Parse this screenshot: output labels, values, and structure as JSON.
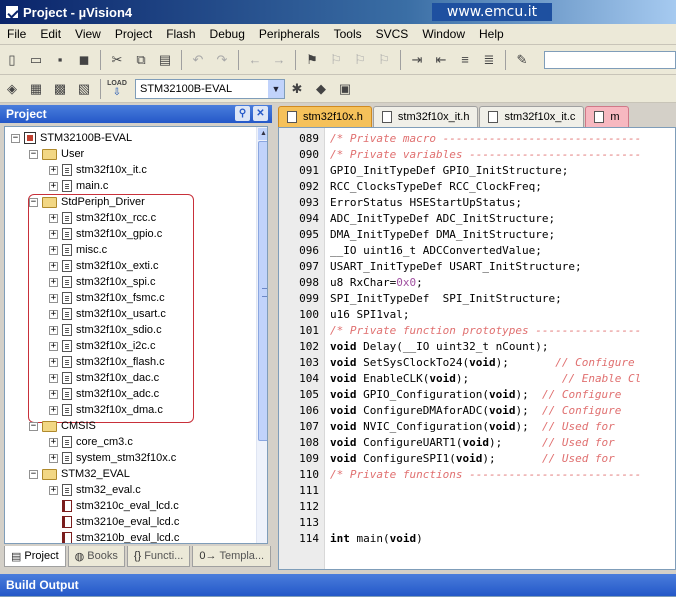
{
  "window": {
    "title": "Project - µVision4",
    "watermark": "www.emcu.it"
  },
  "menu": [
    "File",
    "Edit",
    "View",
    "Project",
    "Flash",
    "Debug",
    "Peripherals",
    "Tools",
    "SVCS",
    "Window",
    "Help"
  ],
  "toolbar": {
    "target_select": "STM32100B-EVAL",
    "load_label": "LOAD",
    "icons1": [
      "new-file-icon",
      "open-folder-icon",
      "save-icon",
      "save-all-icon",
      "cut-icon",
      "copy-icon",
      "paste-icon",
      "undo-icon",
      "redo-icon",
      "nav-back-icon",
      "nav-forward-icon",
      "bookmark-icon",
      "bookmark-prev-icon",
      "bookmark-next-icon",
      "bookmark-clear-icon",
      "indent-icon",
      "unindent-icon",
      "comment-icon",
      "uncomment-icon",
      "find-in-files-icon"
    ],
    "icons2": [
      "translate-icon",
      "build-icon",
      "rebuild-icon",
      "batch-build-icon",
      "download-icon",
      "target-options-icon",
      "manage-components-icon",
      "books-window-icon"
    ]
  },
  "project_panel": {
    "title": "Project",
    "tree": [
      {
        "label": "STM32100B-EVAL",
        "type": "project",
        "level": 0,
        "expander": "-"
      },
      {
        "label": "User",
        "type": "folder",
        "level": 1,
        "expander": "-"
      },
      {
        "label": "stm32f10x_it.c",
        "type": "file",
        "level": 2,
        "expander": "+"
      },
      {
        "label": "main.c",
        "type": "file",
        "level": 2,
        "expander": "+"
      },
      {
        "label": "StdPeriph_Driver",
        "type": "folder",
        "level": 1,
        "expander": "-"
      },
      {
        "label": "stm32f10x_rcc.c",
        "type": "file",
        "level": 2,
        "expander": "+"
      },
      {
        "label": "stm32f10x_gpio.c",
        "type": "file",
        "level": 2,
        "expander": "+"
      },
      {
        "label": "misc.c",
        "type": "file",
        "level": 2,
        "expander": "+"
      },
      {
        "label": "stm32f10x_exti.c",
        "type": "file",
        "level": 2,
        "expander": "+"
      },
      {
        "label": "stm32f10x_spi.c",
        "type": "file",
        "level": 2,
        "expander": "+"
      },
      {
        "label": "stm32f10x_fsmc.c",
        "type": "file",
        "level": 2,
        "expander": "+"
      },
      {
        "label": "stm32f10x_usart.c",
        "type": "file",
        "level": 2,
        "expander": "+"
      },
      {
        "label": "stm32f10x_sdio.c",
        "type": "file",
        "level": 2,
        "expander": "+"
      },
      {
        "label": "stm32f10x_i2c.c",
        "type": "file",
        "level": 2,
        "expander": "+"
      },
      {
        "label": "stm32f10x_flash.c",
        "type": "file",
        "level": 2,
        "expander": "+"
      },
      {
        "label": "stm32f10x_dac.c",
        "type": "file",
        "level": 2,
        "expander": "+"
      },
      {
        "label": "stm32f10x_adc.c",
        "type": "file",
        "level": 2,
        "expander": "+"
      },
      {
        "label": "stm32f10x_dma.c",
        "type": "file",
        "level": 2,
        "expander": "+"
      },
      {
        "label": "CMSIS",
        "type": "folder",
        "level": 1,
        "expander": "-"
      },
      {
        "label": "core_cm3.c",
        "type": "file",
        "level": 2,
        "expander": "+"
      },
      {
        "label": "system_stm32f10x.c",
        "type": "file",
        "level": 2,
        "expander": "+"
      },
      {
        "label": "STM32_EVAL",
        "type": "folder",
        "level": 1,
        "expander": "-"
      },
      {
        "label": "stm32_eval.c",
        "type": "file",
        "level": 2,
        "expander": "+"
      },
      {
        "label": "stm3210c_eval_lcd.c",
        "type": "hfile",
        "level": 2,
        "expander": ""
      },
      {
        "label": "stm3210e_eval_lcd.c",
        "type": "hfile",
        "level": 2,
        "expander": ""
      },
      {
        "label": "stm3210b_eval_lcd.c",
        "type": "hfile",
        "level": 2,
        "expander": ""
      }
    ],
    "tabs": [
      {
        "label": "Project",
        "icon": "project-tab-icon",
        "glyph": "▤",
        "active": true
      },
      {
        "label": "Books",
        "icon": "books-tab-icon",
        "glyph": "◍",
        "active": false
      },
      {
        "label": "Functi...",
        "icon": "functions-tab-icon",
        "glyph": "{}",
        "active": false
      },
      {
        "label": "Templa...",
        "icon": "templates-tab-icon",
        "glyph": "0→",
        "active": false
      }
    ]
  },
  "editor": {
    "tabs": [
      {
        "label": "stm32f10x.h",
        "state": "active"
      },
      {
        "label": "stm32f10x_it.h",
        "state": "normal"
      },
      {
        "label": "stm32f10x_it.c",
        "state": "normal"
      },
      {
        "label": "m",
        "state": "pink"
      }
    ],
    "lines": [
      {
        "n": "089",
        "parts": [
          [
            "cm",
            "/* Private macro ------------------------------"
          ]
        ]
      },
      {
        "n": "090",
        "parts": [
          [
            "cm",
            "/* Private variables --------------------------"
          ]
        ]
      },
      {
        "n": "091",
        "parts": [
          [
            "",
            "GPIO_InitTypeDef GPIO_InitStructure;"
          ]
        ]
      },
      {
        "n": "092",
        "parts": [
          [
            "",
            "RCC_ClocksTypeDef RCC_ClockFreq;"
          ]
        ]
      },
      {
        "n": "093",
        "parts": [
          [
            "",
            "ErrorStatus HSEStartUpStatus;"
          ]
        ]
      },
      {
        "n": "094",
        "parts": [
          [
            "",
            "ADC_InitTypeDef ADC_InitStructure;"
          ]
        ]
      },
      {
        "n": "095",
        "parts": [
          [
            "",
            "DMA_InitTypeDef DMA_InitStructure;"
          ]
        ]
      },
      {
        "n": "096",
        "parts": [
          [
            "",
            "__IO uint16_t ADCConvertedValue;"
          ]
        ]
      },
      {
        "n": "097",
        "parts": [
          [
            "",
            "USART_InitTypeDef USART_InitStructure;"
          ]
        ]
      },
      {
        "n": "098",
        "parts": [
          [
            "",
            "u8 RxChar="
          ],
          [
            "num",
            "0x0"
          ],
          [
            "",
            ";"
          ]
        ]
      },
      {
        "n": "099",
        "parts": [
          [
            "",
            "SPI_InitTypeDef  SPI_InitStructure;"
          ]
        ]
      },
      {
        "n": "100",
        "parts": [
          [
            "",
            "u16 SPI1val;"
          ]
        ]
      },
      {
        "n": "101",
        "parts": [
          [
            "cm",
            "/* Private function prototypes ----------------"
          ]
        ]
      },
      {
        "n": "102",
        "parts": [
          [
            "kw",
            "void"
          ],
          [
            "",
            " Delay(__IO uint32_t nCount);"
          ]
        ]
      },
      {
        "n": "103",
        "parts": [
          [
            "kw",
            "void"
          ],
          [
            "",
            " SetSysClockTo24("
          ],
          [
            "kw",
            "void"
          ],
          [
            "",
            ");       "
          ],
          [
            "cm",
            "// Configure"
          ]
        ]
      },
      {
        "n": "104",
        "parts": [
          [
            "kw",
            "void"
          ],
          [
            "",
            " EnableCLK("
          ],
          [
            "kw",
            "void"
          ],
          [
            "",
            ");              "
          ],
          [
            "cm",
            "// Enable Cl"
          ]
        ]
      },
      {
        "n": "105",
        "parts": [
          [
            "kw",
            "void"
          ],
          [
            "",
            " GPIO_Configuration("
          ],
          [
            "kw",
            "void"
          ],
          [
            "",
            ");  "
          ],
          [
            "cm",
            "// Configure"
          ]
        ]
      },
      {
        "n": "106",
        "parts": [
          [
            "kw",
            "void"
          ],
          [
            "",
            " ConfigureDMAforADC("
          ],
          [
            "kw",
            "void"
          ],
          [
            "",
            ");  "
          ],
          [
            "cm",
            "// Configure"
          ]
        ]
      },
      {
        "n": "107",
        "parts": [
          [
            "kw",
            "void"
          ],
          [
            "",
            " NVIC_Configuration("
          ],
          [
            "kw",
            "void"
          ],
          [
            "",
            ");  "
          ],
          [
            "cm",
            "// Used for"
          ]
        ]
      },
      {
        "n": "108",
        "parts": [
          [
            "kw",
            "void"
          ],
          [
            "",
            " ConfigureUART1("
          ],
          [
            "kw",
            "void"
          ],
          [
            "",
            ");      "
          ],
          [
            "cm",
            "// Used for"
          ]
        ]
      },
      {
        "n": "109",
        "parts": [
          [
            "kw",
            "void"
          ],
          [
            "",
            " ConfigureSPI1("
          ],
          [
            "kw",
            "void"
          ],
          [
            "",
            ");       "
          ],
          [
            "cm",
            "// Used for"
          ]
        ]
      },
      {
        "n": "110",
        "parts": [
          [
            "cm",
            "/* Private functions --------------------------"
          ]
        ]
      },
      {
        "n": "111",
        "parts": []
      },
      {
        "n": "112",
        "parts": []
      },
      {
        "n": "113",
        "parts": []
      },
      {
        "n": "114",
        "parts": [
          [
            "kw",
            "int"
          ],
          [
            "",
            " main("
          ],
          [
            "kw",
            "void"
          ],
          [
            "",
            ")"
          ]
        ]
      }
    ]
  },
  "build_output": {
    "title": "Build Output"
  },
  "colors": {
    "title_bar_start": "#0a246a",
    "panel_header": "#2458c8",
    "comment": "#e07070",
    "highlight_box": "#c8303a",
    "active_tab": "#f5c15a"
  }
}
